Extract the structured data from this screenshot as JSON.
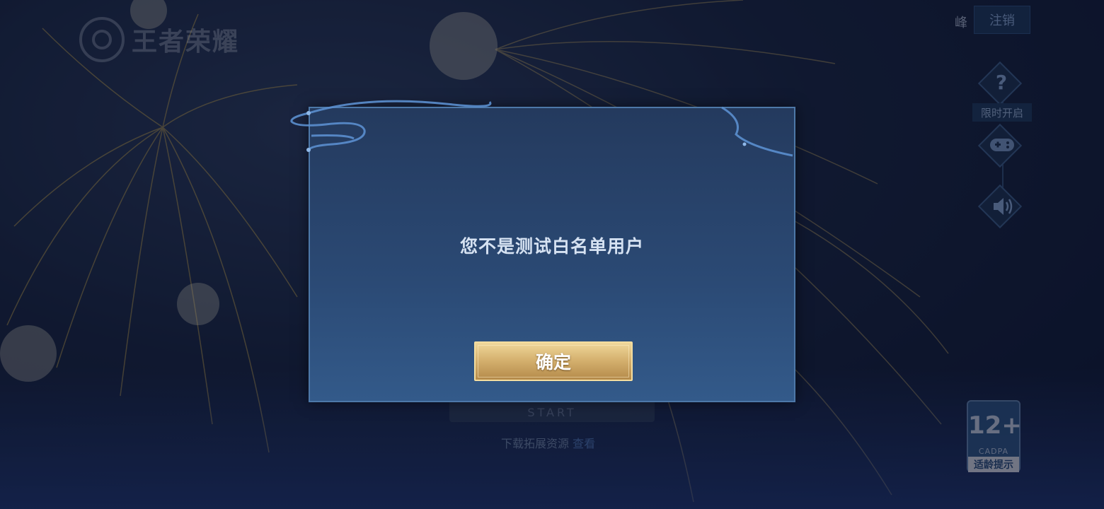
{
  "header": {
    "logo_text": "王者荣耀",
    "user_name": "峰",
    "logout_label": "注销"
  },
  "side_menu": {
    "help_glyph": "?",
    "limited_label": "限时开启",
    "gamepad_icon": "gamepad-icon",
    "sound_icon": "speaker-icon"
  },
  "age_rating": {
    "number": "12+",
    "org": "CADPA",
    "hint": "适龄提示"
  },
  "background": {
    "start_label": "START",
    "download_prefix": "下载拓展资源",
    "download_link": "查看"
  },
  "dialog": {
    "message": "您不是测试白名单用户",
    "confirm_label": "确定"
  },
  "colors": {
    "modal_bg": "#2b4a75",
    "modal_border": "#4d78a8",
    "button_gold": "#d6b270",
    "text_light": "#d6e2f2"
  }
}
